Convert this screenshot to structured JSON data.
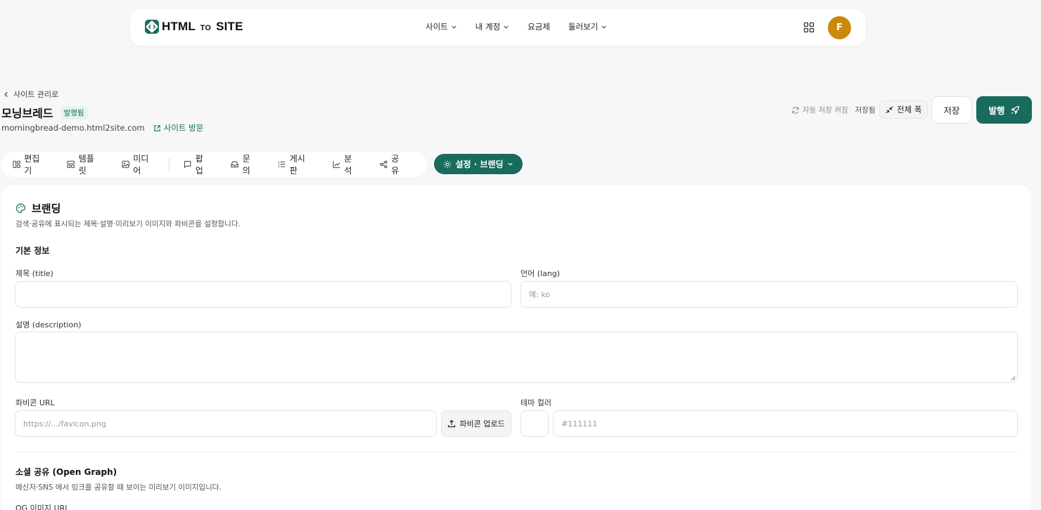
{
  "brand": {
    "logo_left": "HTML",
    "logo_mid": "TO",
    "logo_right": "SITE",
    "accent": "#186b5d",
    "avatar_color": "#c98a0c"
  },
  "nav": {
    "items": [
      {
        "label": "사이트",
        "dropdown": true
      },
      {
        "label": "내 계정",
        "dropdown": true
      },
      {
        "label": "요금제",
        "dropdown": false
      },
      {
        "label": "둘러보기",
        "dropdown": true
      }
    ],
    "apps_icon": "grid-icon",
    "avatar_initial": "F"
  },
  "header": {
    "back_label": "사이트 관리로",
    "site_name": "모닝브레드",
    "status_badge": "발행됨",
    "site_url": "morningbread-demo.html2site.com",
    "visit_label": "사이트 방문",
    "autosave_label": "자동 저장 켜짐",
    "saved_label": "저장됨",
    "fullwidth_label": "전체 폭",
    "save_label": "저장",
    "publish_label": "발행"
  },
  "tabs": {
    "items": [
      {
        "label": "편집기",
        "icon": "editor-icon"
      },
      {
        "label": "템플릿",
        "icon": "template-icon"
      },
      {
        "label": "미디어",
        "icon": "media-icon"
      },
      {
        "label": "팝업",
        "icon": "popup-icon"
      },
      {
        "label": "문의",
        "icon": "inbox-icon"
      },
      {
        "label": "게시판",
        "icon": "list-icon"
      },
      {
        "label": "분석",
        "icon": "chart-icon"
      },
      {
        "label": "공유",
        "icon": "share-icon"
      }
    ],
    "active_label": "설정 · 브랜딩"
  },
  "branding": {
    "title": "브랜딩",
    "description": "검색·공유에 표시되는 제목·설명·미리보기 이미지와 파비콘을 설정합니다.",
    "basic_section": "기본 정보",
    "title_label": "제목 (title)",
    "title_value": "",
    "lang_label": "언어 (lang)",
    "lang_placeholder": "예: ko",
    "desc_label": "설명 (description)",
    "desc_value": "",
    "favicon_label": "파비콘 URL",
    "favicon_placeholder": "https://.../favicon.png",
    "upload_label": "파비콘 업로드",
    "theme_label": "테마 컬러",
    "theme_placeholder": "#111111",
    "og_section": "소셜 공유 (Open Graph)",
    "og_description": "메신저·SNS 에서 링크를 공유할 때 보이는 미리보기 이미지입니다.",
    "og_image_label": "OG 이미지 URL"
  }
}
